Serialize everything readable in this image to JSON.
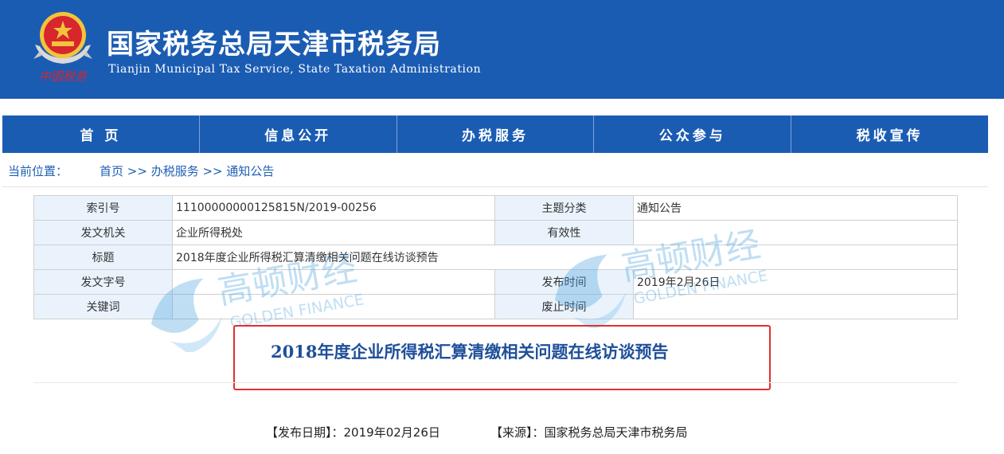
{
  "header": {
    "title_cn": "国家税务总局天津市税务局",
    "title_en": "Tianjin Municipal Tax Service, State Taxation Administration",
    "emblem_text": "中国税务",
    "bg_color": "#1b5cb3"
  },
  "nav": {
    "items": [
      {
        "label": "首 页"
      },
      {
        "label": "信息公开"
      },
      {
        "label": "办税服务"
      },
      {
        "label": "公众参与"
      },
      {
        "label": "税收宣传"
      }
    ]
  },
  "breadcrumb": {
    "label": "当前位置：",
    "crumbs": [
      "首页",
      "办税服务",
      "通知公告"
    ],
    "separator": " >> "
  },
  "meta": {
    "rows": [
      {
        "k1": "索引号",
        "v1": "11100000000125815N/2019-00256",
        "k2": "主题分类",
        "v2": "通知公告"
      },
      {
        "k1": "发文机关",
        "v1": "企业所得税处",
        "k2": "有效性",
        "v2": ""
      },
      {
        "k1": "标题",
        "v1": "2018年度企业所得税汇算清缴相关问题在线访谈预告"
      },
      {
        "k1": "发文字号",
        "v1": "",
        "k2": "发布时间",
        "v2": "2019年2月26日"
      },
      {
        "k1": "关键词",
        "v1": "",
        "k2": "废止时间",
        "v2": ""
      }
    ]
  },
  "watermark": {
    "cn": "高顿财经",
    "en": "GOLDEN FINANCE"
  },
  "article": {
    "title": "2018年度企业所得税汇算清缴相关问题在线访谈预告",
    "publish_label": "【发布日期】：",
    "publish_date": "2019年02月26日",
    "source_label": "【来源】：",
    "source": "国家税务总局天津市税务局"
  },
  "colors": {
    "accent": "#1b5cb3",
    "link": "#1f5fb4",
    "highlight_box": "#e03030"
  }
}
